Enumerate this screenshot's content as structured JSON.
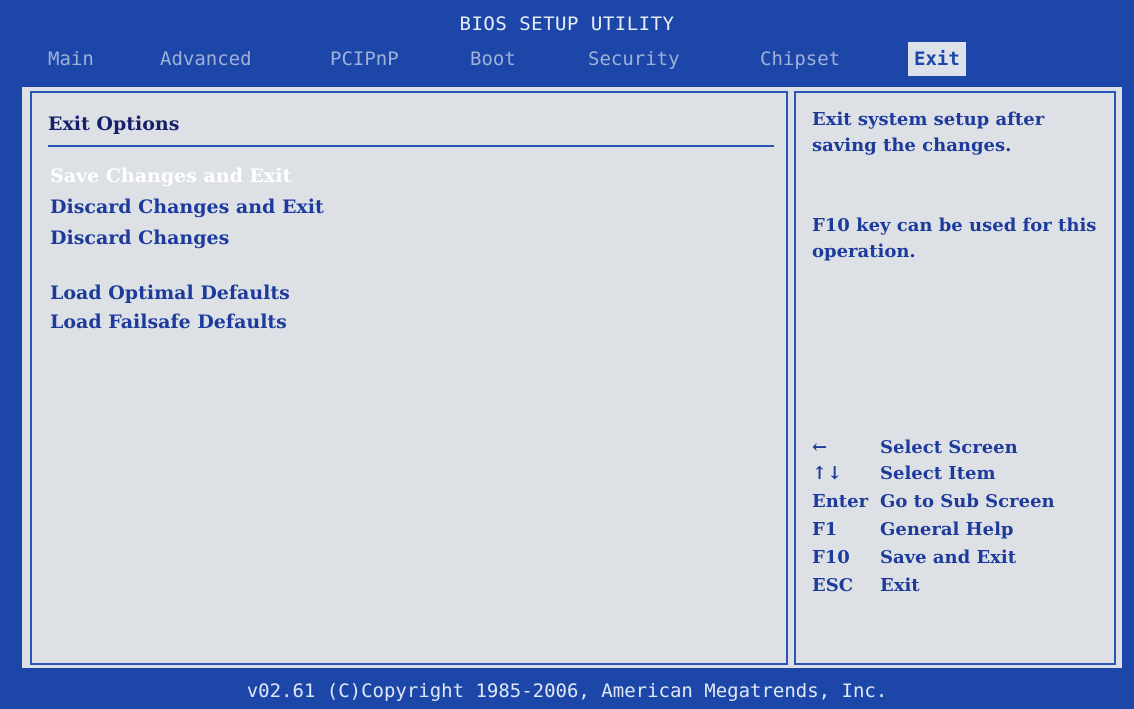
{
  "title": "BIOS SETUP UTILITY",
  "menu": {
    "tabs": [
      {
        "label": "Main"
      },
      {
        "label": "Advanced"
      },
      {
        "label": "PCIPnP"
      },
      {
        "label": "Boot"
      },
      {
        "label": "Security"
      },
      {
        "label": "Chipset"
      },
      {
        "label": "Exit",
        "active": true
      }
    ]
  },
  "left": {
    "section_title": "Exit Options",
    "options": [
      {
        "label": "Save Changes and Exit",
        "selected": true
      },
      {
        "label": "Discard Changes and Exit"
      },
      {
        "label": "Discard Changes"
      },
      {
        "label": "Load Optimal Defaults"
      },
      {
        "label": "Load Failsafe Defaults"
      }
    ]
  },
  "right": {
    "help_text_1": "Exit system setup after saving the changes.",
    "help_text_2": "F10 key can be used for this operation.",
    "keys": [
      {
        "key": "←",
        "desc": "Select Screen"
      },
      {
        "key": "↑↓",
        "desc": "Select Item"
      },
      {
        "key": "Enter",
        "desc": "Go to Sub Screen"
      },
      {
        "key": "F1",
        "desc": "General Help"
      },
      {
        "key": "F10",
        "desc": "Save and Exit"
      },
      {
        "key": "ESC",
        "desc": "Exit"
      }
    ]
  },
  "footer": "v02.61 (C)Copyright 1985-2006, American Megatrends, Inc.",
  "colors": {
    "background": "#1c47a8",
    "panel": "#dde0e4",
    "text": "#1c3b9c",
    "selected": "#ffffff"
  }
}
